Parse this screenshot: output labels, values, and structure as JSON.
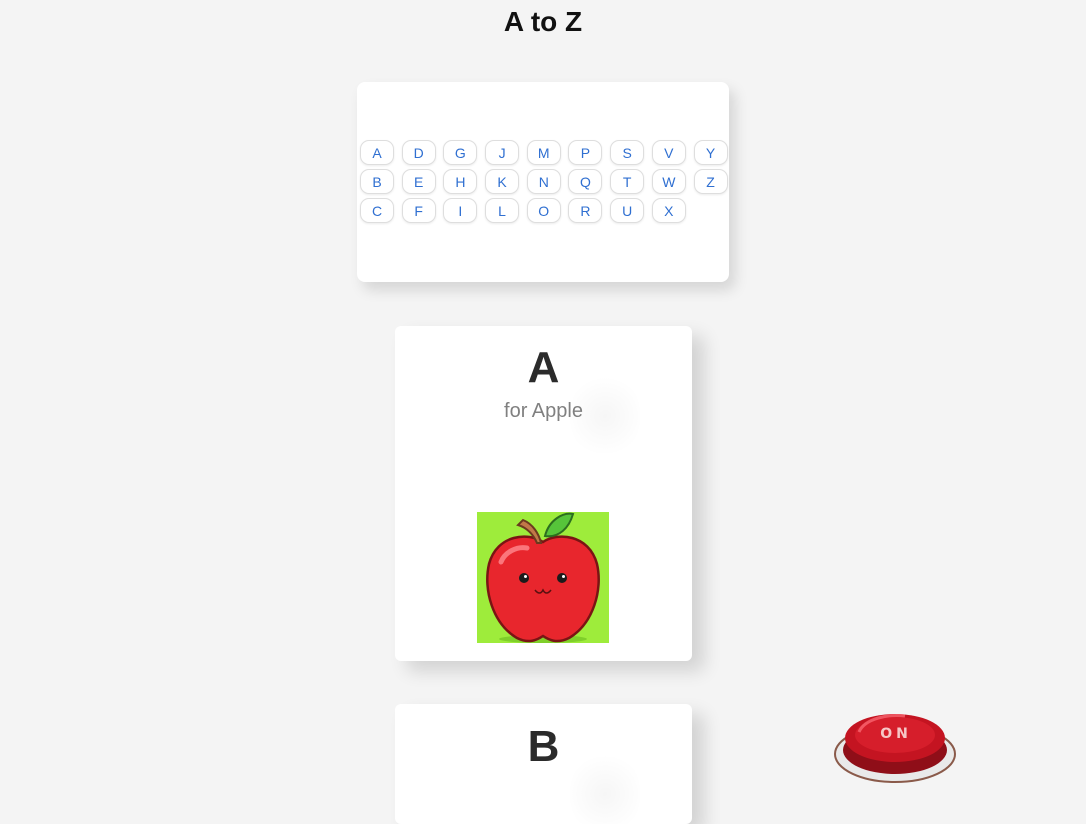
{
  "page": {
    "title": "A to Z"
  },
  "alphabet": {
    "letters": [
      "A",
      "B",
      "C",
      "D",
      "E",
      "F",
      "G",
      "H",
      "I",
      "J",
      "K",
      "L",
      "M",
      "N",
      "O",
      "P",
      "Q",
      "R",
      "S",
      "T",
      "U",
      "V",
      "W",
      "X",
      "Y",
      "Z"
    ]
  },
  "cards": [
    {
      "letter": "A",
      "word": "for Apple",
      "image_icon": "apple-icon"
    },
    {
      "letter": "B"
    }
  ],
  "power_button": {
    "label": "ON",
    "icon": "power-button-icon"
  },
  "colors": {
    "page_bg": "#f4f4f4",
    "letter_text": "#2f6fd1",
    "apple_bg": "#a3ef3f",
    "apple_red": "#e8262d",
    "button_red": "#c41421"
  }
}
